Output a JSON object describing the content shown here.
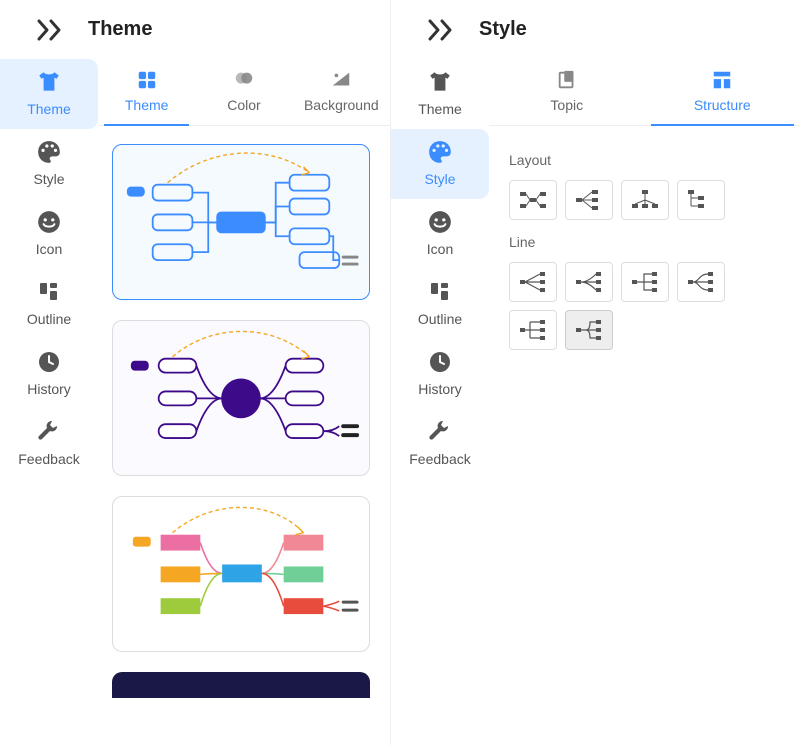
{
  "panels": {
    "left": {
      "title": "Theme",
      "sidenav": [
        {
          "key": "theme",
          "label": "Theme",
          "active": true
        },
        {
          "key": "style",
          "label": "Style",
          "active": false
        },
        {
          "key": "icon",
          "label": "Icon",
          "active": false
        },
        {
          "key": "outline",
          "label": "Outline",
          "active": false
        },
        {
          "key": "history",
          "label": "History",
          "active": false
        },
        {
          "key": "feedback",
          "label": "Feedback",
          "active": false
        }
      ],
      "tabs": [
        {
          "key": "theme",
          "label": "Theme",
          "active": true
        },
        {
          "key": "color",
          "label": "Color",
          "active": false
        },
        {
          "key": "background",
          "label": "Background",
          "active": false
        }
      ]
    },
    "right": {
      "title": "Style",
      "sidenav": [
        {
          "key": "theme",
          "label": "Theme",
          "active": false
        },
        {
          "key": "style",
          "label": "Style",
          "active": true
        },
        {
          "key": "icon",
          "label": "Icon",
          "active": false
        },
        {
          "key": "outline",
          "label": "Outline",
          "active": false
        },
        {
          "key": "history",
          "label": "History",
          "active": false
        },
        {
          "key": "feedback",
          "label": "Feedback",
          "active": false
        }
      ],
      "tabs": [
        {
          "key": "topic",
          "label": "Topic",
          "active": false
        },
        {
          "key": "structure",
          "label": "Structure",
          "active": true
        }
      ],
      "sections": {
        "layout": {
          "title": "Layout",
          "options": 4,
          "selected": -1
        },
        "line": {
          "title": "Line",
          "options": 6,
          "selected": 5
        }
      }
    }
  }
}
